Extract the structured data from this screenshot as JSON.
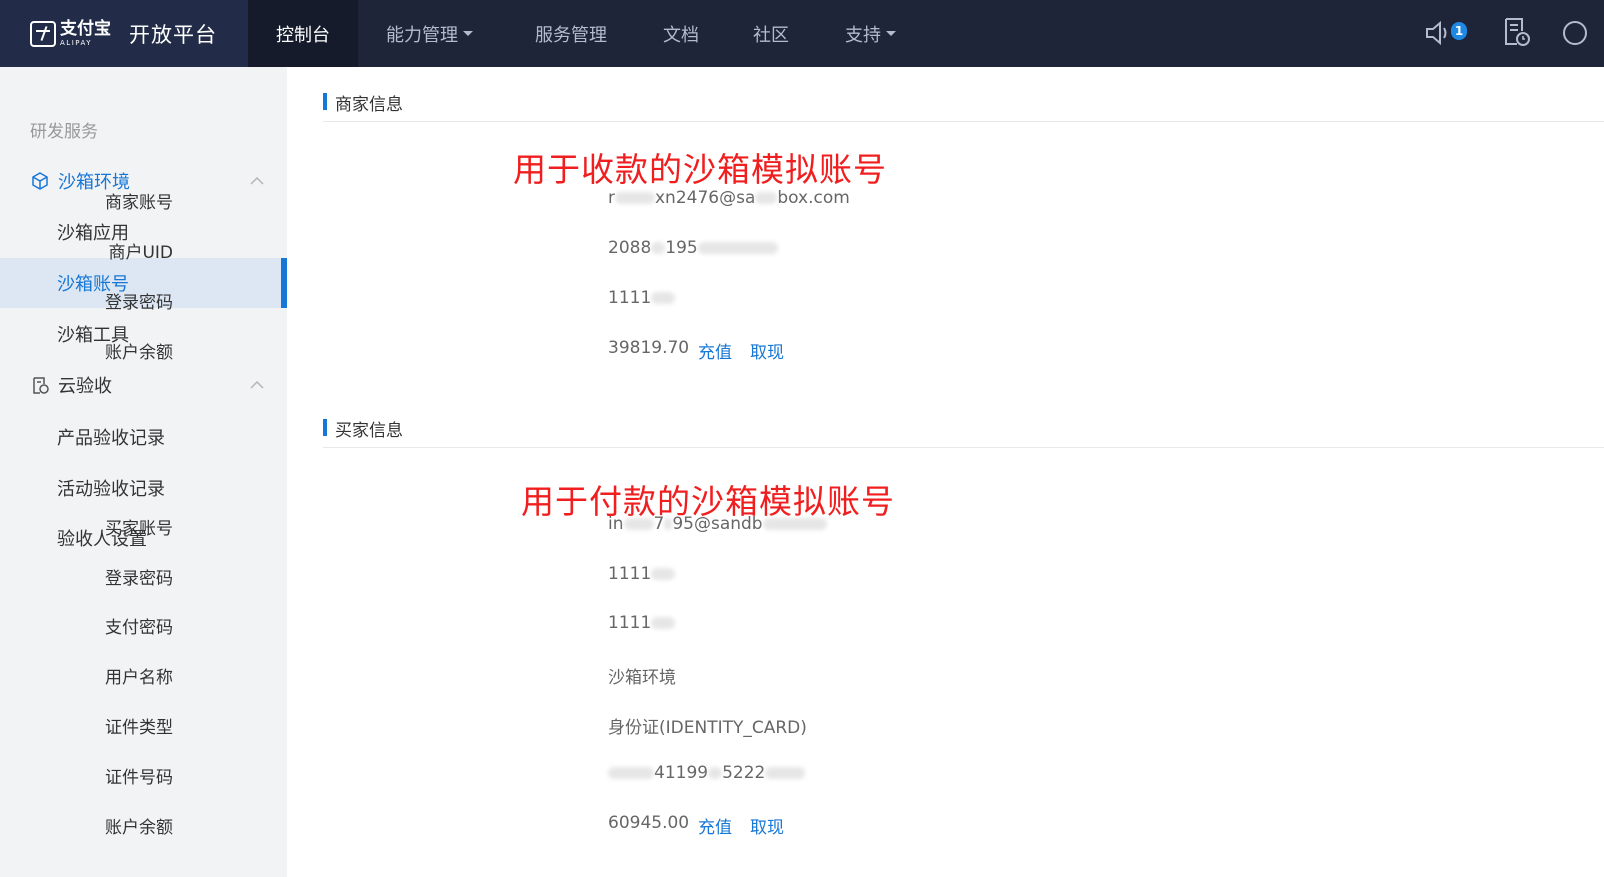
{
  "header": {
    "logo_cn": "支付宝",
    "logo_en": "ALIPAY",
    "title": "开放平台",
    "nav": [
      {
        "label": "控制台",
        "active": true,
        "dropdown": false
      },
      {
        "label": "能力管理",
        "active": false,
        "dropdown": true
      },
      {
        "label": "服务管理",
        "active": false,
        "dropdown": false
      },
      {
        "label": "文档",
        "active": false,
        "dropdown": false
      },
      {
        "label": "社区",
        "active": false,
        "dropdown": false
      },
      {
        "label": "支持",
        "active": false,
        "dropdown": true
      }
    ],
    "notification_count": "1",
    "icons": [
      "speaker-icon",
      "document-icon"
    ]
  },
  "sidebar": {
    "group_title": "研发服务",
    "sandbox": {
      "label": "沙箱环境",
      "items": [
        "沙箱应用",
        "沙箱账号",
        "沙箱工具"
      ],
      "selected": "沙箱账号"
    },
    "cloud": {
      "label": "云验收",
      "items": [
        "产品验收记录",
        "活动验收记录",
        "验收人设置"
      ]
    }
  },
  "merchant": {
    "section_title": "商家信息",
    "annotation": "用于收款的沙箱模拟账号",
    "fields": [
      {
        "label": "商家账号",
        "value_pre": "r",
        "value_post": "xn2476@sa",
        "value_tail": "box.com"
      },
      {
        "label": "商户UID",
        "value_pre": "2088",
        "value_post": "195",
        "value_tail": ""
      },
      {
        "label": "登录密码",
        "value_pre": "1111",
        "value_post": "",
        "value_tail": ""
      },
      {
        "label": "账户余额",
        "value_pre": "39819.70",
        "value_post": "",
        "value_tail": ""
      }
    ],
    "recharge": "充值",
    "withdraw": "取现"
  },
  "buyer": {
    "section_title": "买家信息",
    "annotation": "用于付款的沙箱模拟账号",
    "fields": [
      {
        "label": "买家账号",
        "value_pre": "in",
        "value_post": "7",
        "value_tail": "95@sandb"
      },
      {
        "label": "登录密码",
        "value_pre": "1111",
        "value_post": "",
        "value_tail": ""
      },
      {
        "label": "支付密码",
        "value_pre": "1111",
        "value_post": "",
        "value_tail": ""
      },
      {
        "label": "用户名称",
        "value_pre": "沙箱环境",
        "value_post": "",
        "value_tail": ""
      },
      {
        "label": "证件类型",
        "value_pre": "身份证(IDENTITY_CARD)",
        "value_post": "",
        "value_tail": ""
      },
      {
        "label": "证件号码",
        "value_pre": "",
        "value_post": "41199",
        "value_tail": "5222"
      },
      {
        "label": "账户余额",
        "value_pre": "60945.00",
        "value_post": "",
        "value_tail": ""
      }
    ],
    "recharge": "充值",
    "withdraw": "取现"
  }
}
